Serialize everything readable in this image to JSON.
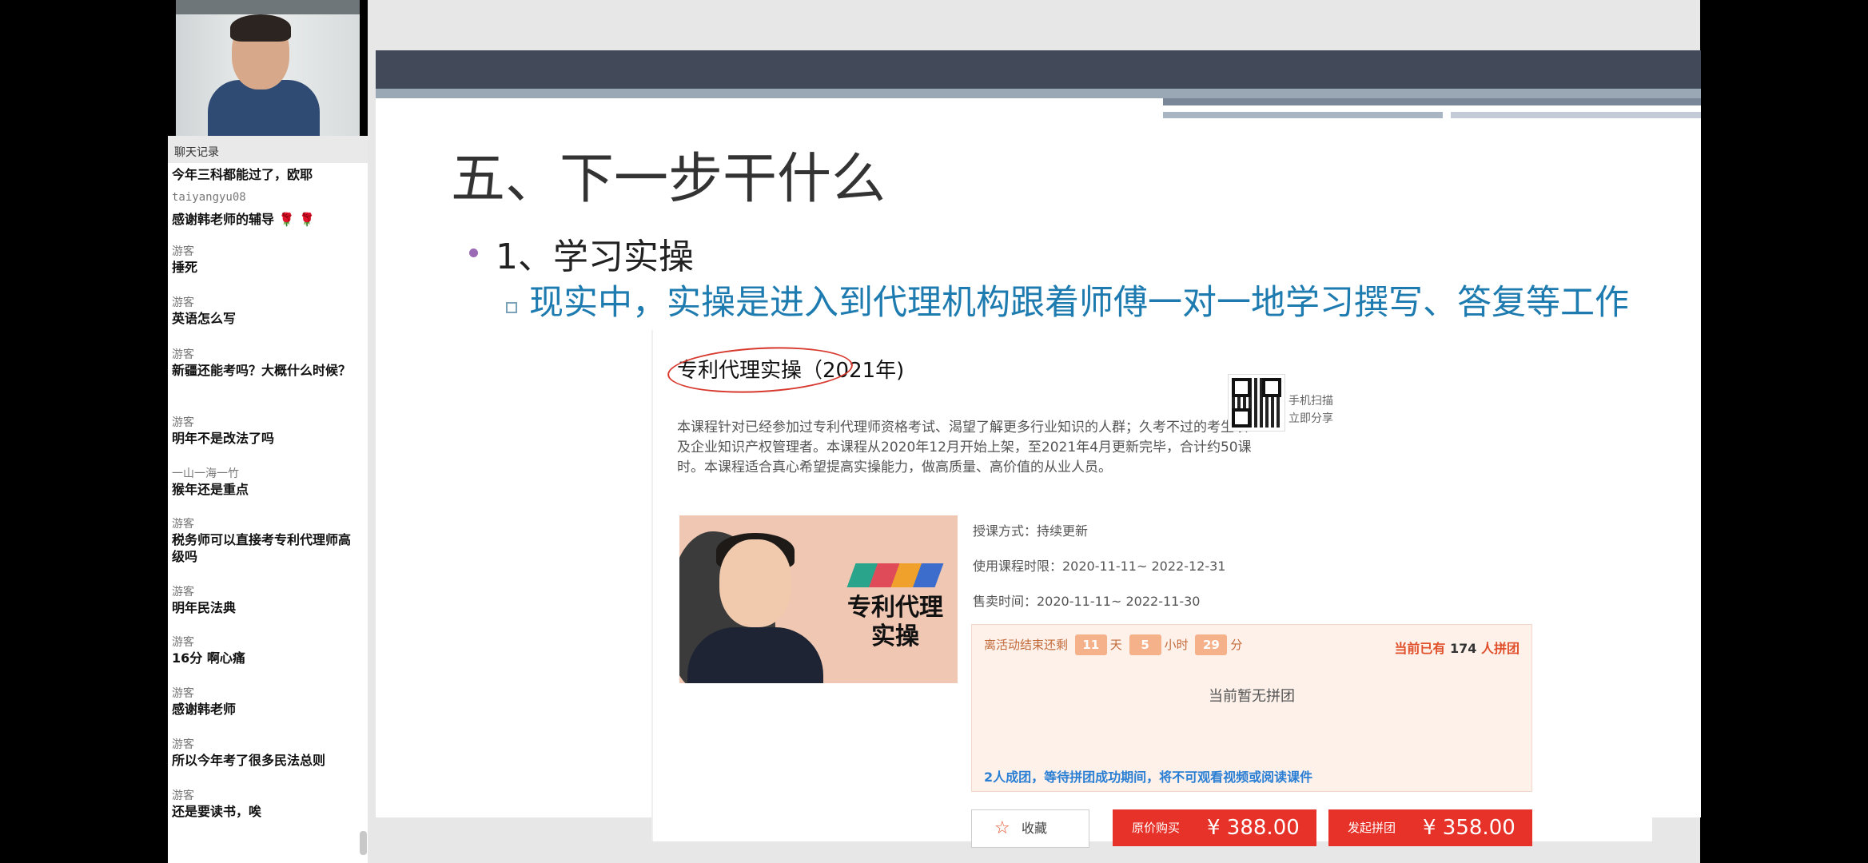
{
  "chat": {
    "title": "聊天记录",
    "messages": [
      {
        "author": "游客",
        "text": "今年三科都能过了，欧耶"
      },
      {
        "author": "taiyangyu08",
        "text": "感谢韩老师的辅导 🌹 🌹"
      },
      {
        "author": "游客",
        "text": "捶死"
      },
      {
        "author": "游客",
        "text": "英语怎么写"
      },
      {
        "author": "游客",
        "text": "新疆还能考吗？大概什么时候？"
      },
      {
        "author": "游客",
        "text": "明年不是改法了吗"
      },
      {
        "author": "一山一海一竹",
        "text": "猴年还是重点"
      },
      {
        "author": "游客",
        "text": "税务师可以直接考专利代理师高级吗"
      },
      {
        "author": "游客",
        "text": "明年民法典"
      },
      {
        "author": "游客",
        "text": "16分 啊心痛"
      },
      {
        "author": "游客",
        "text": "感谢韩老师"
      },
      {
        "author": "游客",
        "text": "所以今年考了很多民法总则"
      },
      {
        "author": "游客",
        "text": "还是要读书，唉"
      }
    ]
  },
  "slide": {
    "title": "五、下一步干什么",
    "bullet1": "1、学习实操",
    "bullet2": "现实中，实操是进入到代理机构跟着师傅一对一地学习撰写、答复等工作"
  },
  "course": {
    "title": "专利代理实操（2021年)",
    "description": "本课程针对已经参加过专利代理师资格考试、渴望了解更多行业知识的人群；久考不过的考生以及企业知识产权管理者。本课程从2020年12月开始上架，至2021年4月更新完毕，合计约50课时。本课程适合真心希望提高实操能力，做高质量、高价值的从业人员。",
    "qr_text_1": "手机扫描",
    "qr_text_2": "立即分享",
    "image_title": "专利代理\n实操",
    "teach_mode": "授课方式：持续更新",
    "use_period": "使用课程时限：2020-11-11~ 2022-12-31",
    "sale_period": "售卖时间：2020-11-11~ 2022-11-30",
    "countdown_prefix": "离活动结束还剩",
    "days": "11",
    "days_unit": "天",
    "hours": "5",
    "hours_unit": "小时",
    "minutes": "29",
    "minutes_unit": "分",
    "joined_prefix": "当前已有",
    "joined_count": "174",
    "joined_suffix": "人拼团",
    "no_group": "当前暂无拼团",
    "group_rule": "2人成团，等待拼团成功期间，将不可观看视频或阅读课件",
    "fav_label": "收藏",
    "buy_label": "原价购买",
    "buy_price": "¥ 388.00",
    "group_label": "发起拼团",
    "group_price": "¥ 358.00"
  }
}
